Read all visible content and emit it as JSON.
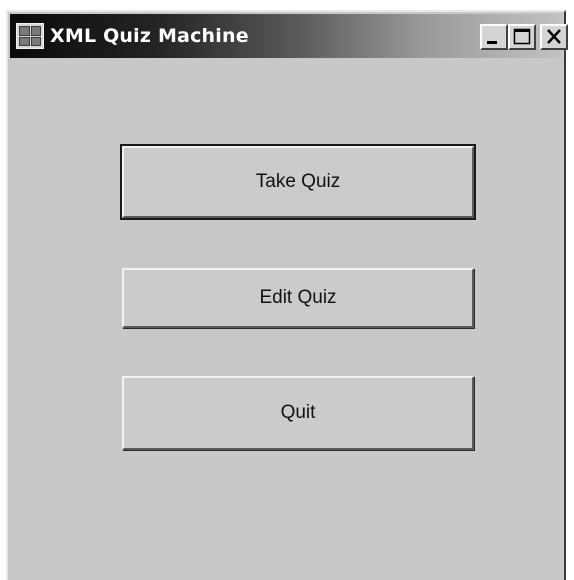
{
  "window": {
    "title": "XML Quiz Machine",
    "controls": {
      "minimize_icon": "minimize-icon",
      "maximize_icon": "maximize-icon",
      "close_icon": "close-icon"
    }
  },
  "buttons": {
    "take_quiz": "Take Quiz",
    "edit_quiz": "Edit Quiz",
    "quit": "Quit"
  },
  "colors": {
    "window_background": "#c8c8c8",
    "titlebar_start": "#0a0a0a",
    "titlebar_end": "#c2c2c2",
    "title_text": "#ffffff"
  }
}
